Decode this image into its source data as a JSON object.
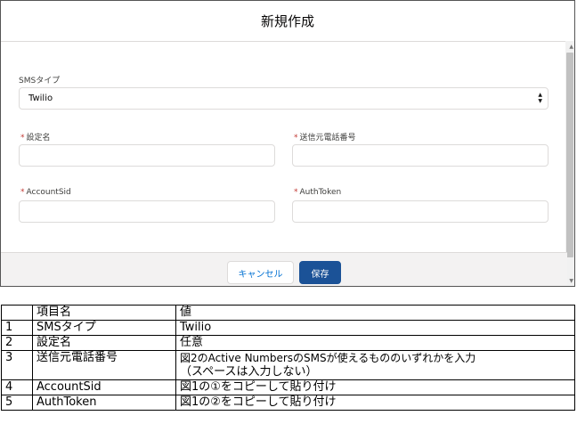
{
  "modal": {
    "title": "新規作成",
    "fields": {
      "sms_type": {
        "label": "SMSタイプ",
        "value": "Twilio"
      },
      "setting_name": {
        "label": "設定名",
        "value": ""
      },
      "sender_phone": {
        "label": "送信元電話番号",
        "value": ""
      },
      "account_sid": {
        "label": "AccountSid",
        "value": ""
      },
      "auth_token": {
        "label": "AuthToken",
        "value": ""
      }
    },
    "required_mark": "*",
    "buttons": {
      "cancel": "キャンセル",
      "save": "保存"
    }
  },
  "table": {
    "header": [
      "",
      "項目名",
      "値"
    ],
    "rows": [
      {
        "no": "1",
        "item": "SMSタイプ",
        "value": "Twilio",
        "value2": ""
      },
      {
        "no": "2",
        "item": "設定名",
        "value": "任意",
        "value2": ""
      },
      {
        "no": "3",
        "item": "送信元電話番号",
        "value": "図2のActive NumbersのSMSが使えるもののいずれかを入力",
        "value2": "（スペースは入力しない）"
      },
      {
        "no": "4",
        "item": "AccountSid",
        "value": "図1の①をコピーして貼り付け",
        "value2": ""
      },
      {
        "no": "5",
        "item": "AuthToken",
        "value": "図1の②をコピーして貼り付け",
        "value2": ""
      }
    ]
  }
}
